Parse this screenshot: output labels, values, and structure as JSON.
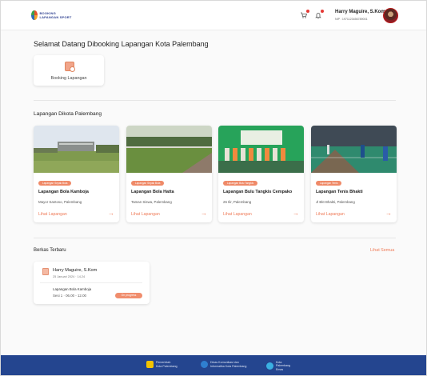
{
  "header": {
    "logo_text": "BOOKING LAPANGAN SPORT",
    "user_name": "Harry Maguire, S.Kom",
    "user_nip": "NIP : 1971123456789001"
  },
  "welcome": {
    "title": "Selamat Datang Dibooking Lapangan Kota Palembang",
    "booking_label": "Booking Lapangan"
  },
  "venues": {
    "title": "Lapangan Dikota Palembang",
    "items": [
      {
        "tag": "Lapangan Sepak Bola",
        "name": "Lapangan Bola Kamboja",
        "address": "Mayor Santoso, Palembang",
        "link": "Lihat Lapangan"
      },
      {
        "tag": "Lapangan Sepak Bola",
        "name": "Lapangan Bola Hatta",
        "address": "Taman Siswa, Palembang",
        "link": "Lihat Lapangan"
      },
      {
        "tag": "Lapangan Bulu Tangkis",
        "name": "Lapangan Bulu Tangkis Cempako",
        "address": "26 Ilir, Palembang",
        "link": "Lihat Lapangan"
      },
      {
        "tag": "Lapangan Tenis",
        "name": "Lapangan Tenis Bhakti",
        "address": "Jl Bkt Bhakti, Palembang",
        "link": "Lihat Lapangan"
      }
    ]
  },
  "berkas": {
    "title": "Berkas Terbaru",
    "see_all": "Lihat Semua",
    "card": {
      "name": "Harry Maguire, S.Kom",
      "date": "25 Januari 2024  ·  14.24",
      "venue": "Lapangan Bola Kamboja",
      "session": "Sesi 1  ·  06.00 - 12.00",
      "status": "On progress"
    }
  },
  "footer": {
    "items": [
      {
        "text": "Pemerintah\nKota Palembang",
        "color": "#f3c400"
      },
      {
        "text": "Dinas Komunikasi dan\nInformatika Kota Palembang",
        "color": "#2f7fd0"
      },
      {
        "text": "Kota\nPalembang\nEmas",
        "color": "#3ab0e2"
      }
    ]
  },
  "colors": {
    "accent": "#ef7b58",
    "footer": "#24458f"
  },
  "icons": {
    "cart": "cart-icon",
    "notification": "bell-icon",
    "booking": "calendar-icon",
    "arrow": "arrow-right-icon",
    "file": "file-icon"
  }
}
